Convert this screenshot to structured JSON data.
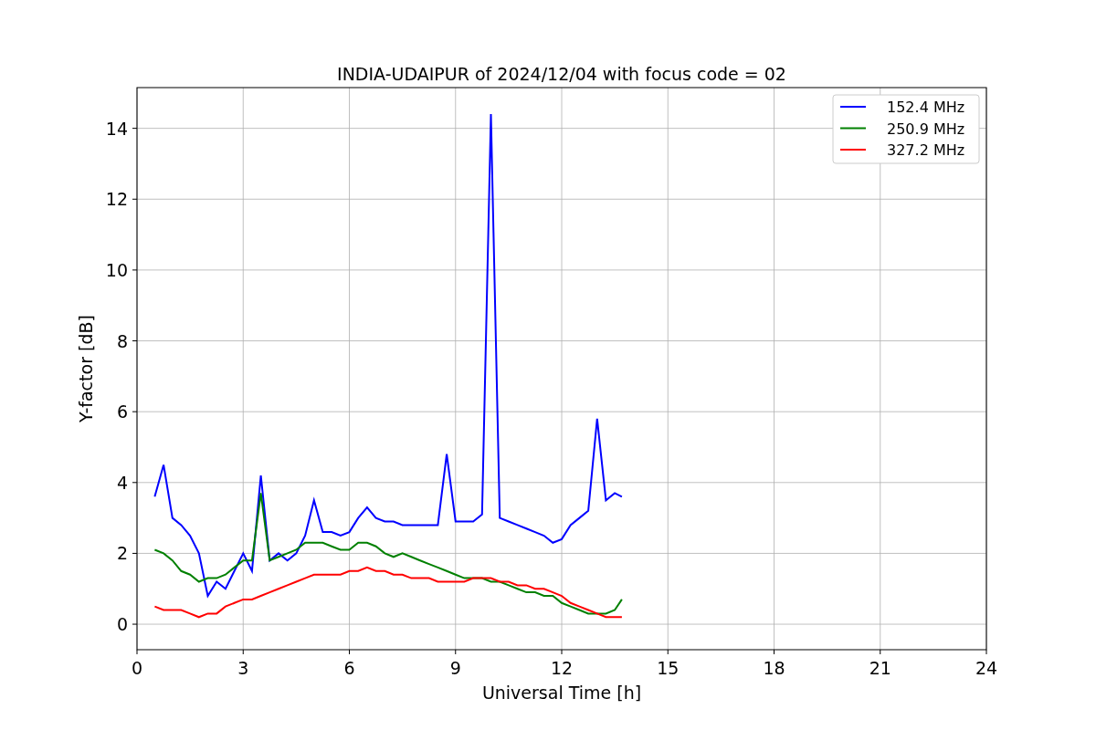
{
  "chart_data": {
    "type": "line",
    "title": "INDIA-UDAIPUR of 2024/12/04 with focus code = 02",
    "xlabel": "Universal Time [h]",
    "ylabel": "Y-factor [dB]",
    "xlim": [
      0,
      24
    ],
    "ylim": [
      -0.72,
      15.15
    ],
    "xticks": [
      0,
      3,
      6,
      9,
      12,
      15,
      18,
      21,
      24
    ],
    "yticks": [
      0,
      2,
      4,
      6,
      8,
      10,
      12,
      14
    ],
    "grid": true,
    "legend": true,
    "x": [
      0.5,
      0.75,
      1,
      1.25,
      1.5,
      1.75,
      2,
      2.25,
      2.5,
      2.75,
      3,
      3.25,
      3.5,
      3.75,
      4,
      4.25,
      4.5,
      4.75,
      5,
      5.25,
      5.5,
      5.75,
      6,
      6.25,
      6.5,
      6.75,
      7,
      7.25,
      7.5,
      7.75,
      8,
      8.25,
      8.5,
      8.75,
      9,
      9.25,
      9.5,
      9.75,
      10,
      10.25,
      10.5,
      10.75,
      11,
      11.25,
      11.5,
      11.75,
      12,
      12.25,
      12.5,
      12.75,
      13,
      13.25,
      13.5,
      13.7
    ],
    "series": [
      {
        "name": "152.4 MHz",
        "color": "#0000ff",
        "values": [
          3.6,
          4.5,
          3.0,
          2.8,
          2.5,
          2.0,
          0.8,
          1.2,
          1.0,
          1.5,
          2.0,
          1.5,
          4.2,
          1.8,
          2.0,
          1.8,
          2.0,
          2.5,
          3.5,
          2.6,
          2.6,
          2.5,
          2.6,
          3.0,
          3.3,
          3.0,
          2.9,
          2.9,
          2.8,
          2.8,
          2.8,
          2.8,
          2.8,
          4.8,
          2.9,
          2.9,
          2.9,
          3.1,
          14.4,
          3.0,
          2.9,
          2.8,
          2.7,
          2.6,
          2.5,
          2.3,
          2.4,
          2.8,
          3.0,
          3.2,
          5.8,
          3.5,
          3.7,
          3.6
        ]
      },
      {
        "name": "250.9 MHz",
        "color": "#008000",
        "values": [
          2.1,
          2.0,
          1.8,
          1.5,
          1.4,
          1.2,
          1.3,
          1.3,
          1.4,
          1.6,
          1.8,
          1.8,
          3.7,
          1.8,
          1.9,
          2.0,
          2.1,
          2.3,
          2.3,
          2.3,
          2.2,
          2.1,
          2.1,
          2.3,
          2.3,
          2.2,
          2.0,
          1.9,
          2.0,
          1.9,
          1.8,
          1.7,
          1.6,
          1.5,
          1.4,
          1.3,
          1.3,
          1.3,
          1.2,
          1.2,
          1.1,
          1.0,
          0.9,
          0.9,
          0.8,
          0.8,
          0.6,
          0.5,
          0.4,
          0.3,
          0.3,
          0.3,
          0.4,
          0.7
        ]
      },
      {
        "name": "327.2 MHz",
        "color": "#ff0000",
        "values": [
          0.5,
          0.4,
          0.4,
          0.4,
          0.3,
          0.2,
          0.3,
          0.3,
          0.5,
          0.6,
          0.7,
          0.7,
          0.8,
          0.9,
          1.0,
          1.1,
          1.2,
          1.3,
          1.4,
          1.4,
          1.4,
          1.4,
          1.5,
          1.5,
          1.6,
          1.5,
          1.5,
          1.4,
          1.4,
          1.3,
          1.3,
          1.3,
          1.2,
          1.2,
          1.2,
          1.2,
          1.3,
          1.3,
          1.3,
          1.2,
          1.2,
          1.1,
          1.1,
          1.0,
          1.0,
          0.9,
          0.8,
          0.6,
          0.5,
          0.4,
          0.3,
          0.2,
          0.2,
          0.2
        ]
      }
    ]
  }
}
